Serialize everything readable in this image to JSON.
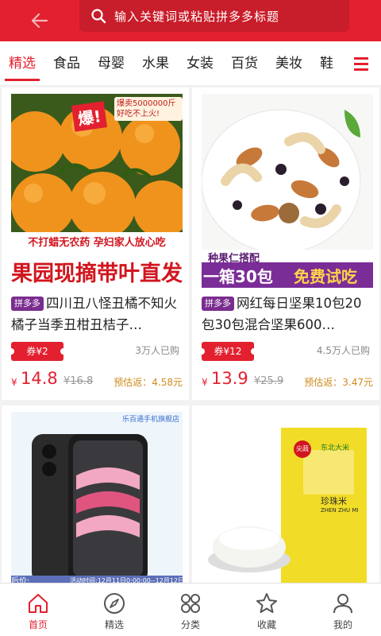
{
  "header": {
    "search_placeholder": "输入关键词或粘贴拼多多标题"
  },
  "tabs": [
    {
      "label": "精选"
    },
    {
      "label": "食品"
    },
    {
      "label": "母婴"
    },
    {
      "label": "水果"
    },
    {
      "label": "女装"
    },
    {
      "label": "百货"
    },
    {
      "label": "美妆"
    },
    {
      "label": "鞋"
    }
  ],
  "products": [
    {
      "badge": "拼多多",
      "title": "四川丑八怪丑橘不知火橘子当季丑柑丑桔子…",
      "coupon": "券¥2",
      "sold": "3万人已购",
      "currency": "¥",
      "price": "14.8",
      "original_price": "¥16.8",
      "estimated_rebate": "预估返：4.58元",
      "image_banner_top": "爆!",
      "image_tag": "爆卖5000000斤 好吃不上火!",
      "image_line1": "不打蜡无农药  孕妇家人放心吃",
      "image_line2": "果园现摘带叶直发"
    },
    {
      "badge": "拼多多",
      "title": "网红每日坚果10包20包30包混合坚果600…",
      "coupon": "券¥12",
      "sold": "4.5万人已购",
      "currency": "¥",
      "price": "13.9",
      "original_price": "¥25.9",
      "estimated_rebate": "预估返：3.47元",
      "image_line1": "种果仁搭配",
      "image_line2": "一箱30包",
      "image_line3": "免费试吃"
    },
    {
      "image_tag": "乐百通手机旗舰店",
      "image_footer": "活动时间:12月11日0:00:00--12月12日23:59",
      "image_side": "后价:"
    },
    {
      "image_brand": "东北大米",
      "image_name": "珍珠米",
      "image_pinyin": "ZHEN ZHU MI",
      "image_seal": "尖蔬"
    }
  ],
  "bottom_nav": [
    {
      "label": "首页",
      "icon": "home-icon"
    },
    {
      "label": "精选",
      "icon": "compass-icon"
    },
    {
      "label": "分类",
      "icon": "grid-icon"
    },
    {
      "label": "收藏",
      "icon": "star-icon"
    },
    {
      "label": "我的",
      "icon": "user-icon"
    }
  ],
  "colors": {
    "brand": "#e3202f",
    "badge": "#7a2c8f",
    "rebate": "#d08a1c"
  }
}
